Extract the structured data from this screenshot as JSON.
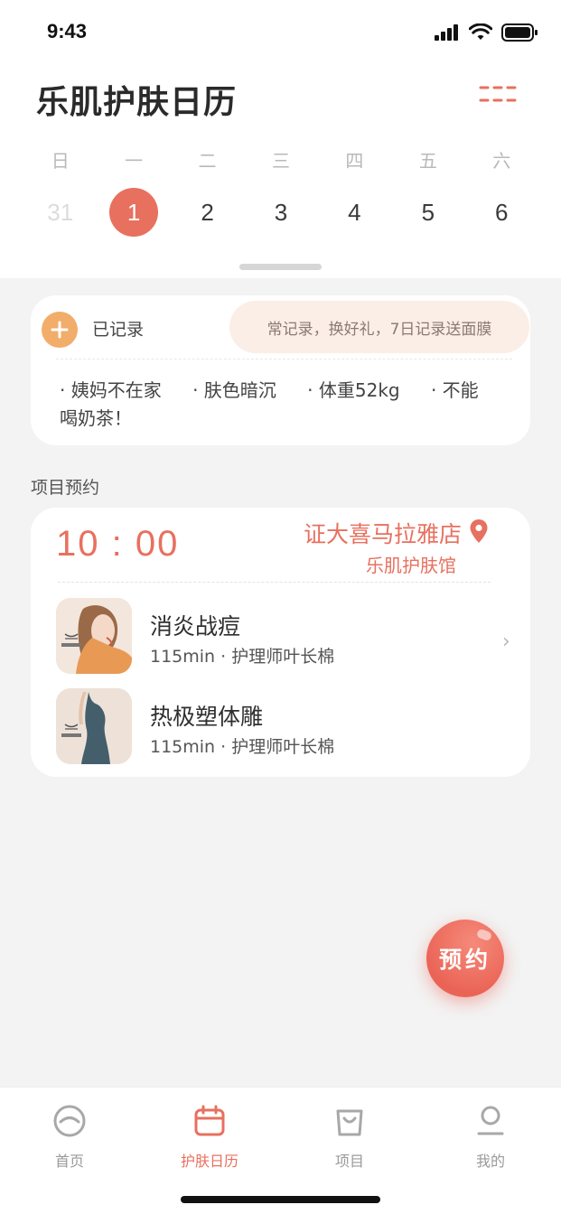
{
  "status": {
    "time": "9:43"
  },
  "header": {
    "title": "乐肌护肤日历",
    "menu_icon": "menu-icon"
  },
  "calendar": {
    "weekdays": [
      "日",
      "一",
      "二",
      "三",
      "四",
      "五",
      "六"
    ],
    "dates": [
      "31",
      "1",
      "2",
      "3",
      "4",
      "5",
      "6"
    ],
    "selected_index": 1
  },
  "record": {
    "label": "已记录",
    "promo": "常记录，换好礼，7日记录送面膜",
    "tags": [
      "· 姨妈不在家",
      "· 肤色暗沉",
      "· 体重52kg",
      "· 不能喝奶茶！"
    ]
  },
  "appointments": {
    "section_title": "项目预约",
    "time": "10 : 00",
    "store": "证大喜马拉雅店",
    "brand": "乐肌护肤馆",
    "items": [
      {
        "name": "消炎战痘",
        "meta": "115min · 护理师叶长棉"
      },
      {
        "name": "热极塑体雕",
        "meta": "115min · 护理师叶长棉"
      }
    ],
    "chevron": "›"
  },
  "fab": {
    "label": "预约"
  },
  "tabbar": {
    "tabs": [
      {
        "label": "首页",
        "icon": "home-face-icon"
      },
      {
        "label": "护肤日历",
        "icon": "calendar-icon"
      },
      {
        "label": "项目",
        "icon": "bag-icon"
      },
      {
        "label": "我的",
        "icon": "person-icon"
      }
    ],
    "active_index": 1
  },
  "colors": {
    "accent": "#e8705f",
    "add": "#f2ad6a",
    "promo_bg": "#fbeee6",
    "bg": "#f3f3f3"
  }
}
